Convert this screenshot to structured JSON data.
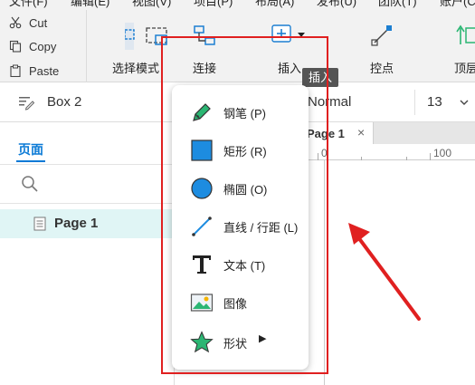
{
  "menubar": [
    "文件(F)",
    "编辑(E)",
    "视图(V)",
    "项目(P)",
    "布局(A)",
    "发布(U)",
    "团队(T)",
    "账户(C)"
  ],
  "clipboard": {
    "cut": "Cut",
    "copy": "Copy",
    "paste": "Paste"
  },
  "toolbar": {
    "select_mode": "选择模式",
    "connect": "连接",
    "insert": "插入",
    "point": "控点",
    "top": "顶层"
  },
  "tooltip": "插入",
  "props": {
    "selected": "Box 2",
    "font_style": "Normal",
    "font_size": "13"
  },
  "left": {
    "tab": "页面",
    "page": "Page 1"
  },
  "canvas": {
    "tab": "Page 1",
    "tab_close": "×",
    "ruler_0": "0",
    "ruler_100": "100"
  },
  "menu": {
    "pen": "钢笔 (P)",
    "rect": "矩形 (R)",
    "ellipse": "椭圆 (O)",
    "line": "直线 / 行距 (L)",
    "text": "文本 (T)",
    "image": "图像",
    "shape": "形状"
  },
  "colors": {
    "accent": "#0a7ad6",
    "highlight": "#e02020",
    "selection": "#e0f5f5",
    "shape_blue": "#1d8ce0",
    "star_green": "#2bb673"
  }
}
